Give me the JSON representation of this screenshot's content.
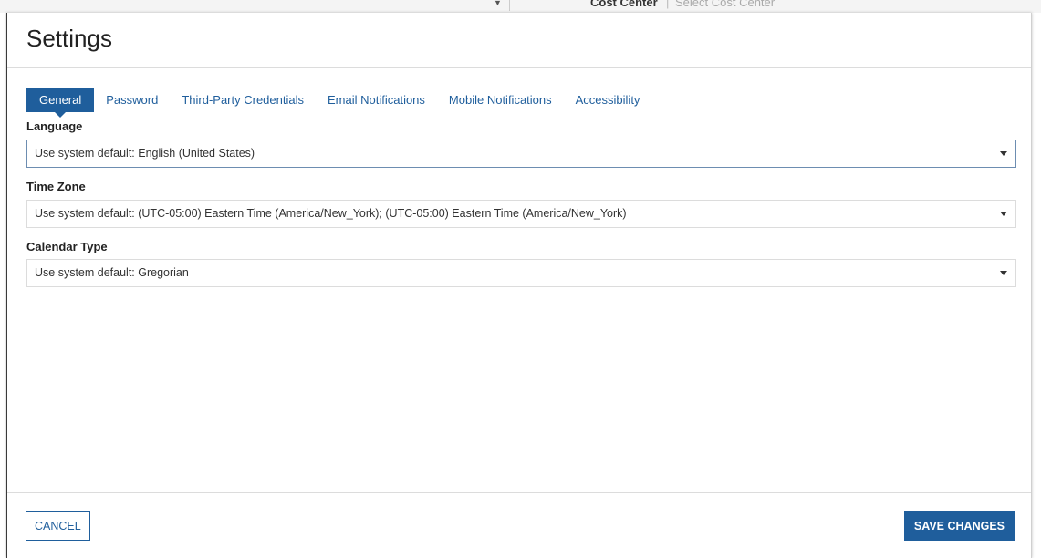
{
  "background": {
    "label": "Cost Center",
    "separator": "|",
    "placeholder": "Select Cost Center"
  },
  "modal": {
    "title": "Settings",
    "tabs": [
      {
        "label": "General",
        "active": true
      },
      {
        "label": "Password",
        "active": false
      },
      {
        "label": "Third-Party Credentials",
        "active": false
      },
      {
        "label": "Email Notifications",
        "active": false
      },
      {
        "label": "Mobile Notifications",
        "active": false
      },
      {
        "label": "Accessibility",
        "active": false
      }
    ],
    "fields": {
      "language": {
        "label": "Language",
        "value": "Use system default: English (United States)"
      },
      "timezone": {
        "label": "Time Zone",
        "value": "Use system default: (UTC-05:00) Eastern Time (America/New_York); (UTC-05:00) Eastern Time (America/New_York)"
      },
      "calendar": {
        "label": "Calendar Type",
        "value": "Use system default: Gregorian"
      }
    },
    "footer": {
      "cancel_label": "CANCEL",
      "save_label": "SAVE CHANGES"
    }
  },
  "colors": {
    "accent": "#1f5e9c"
  }
}
